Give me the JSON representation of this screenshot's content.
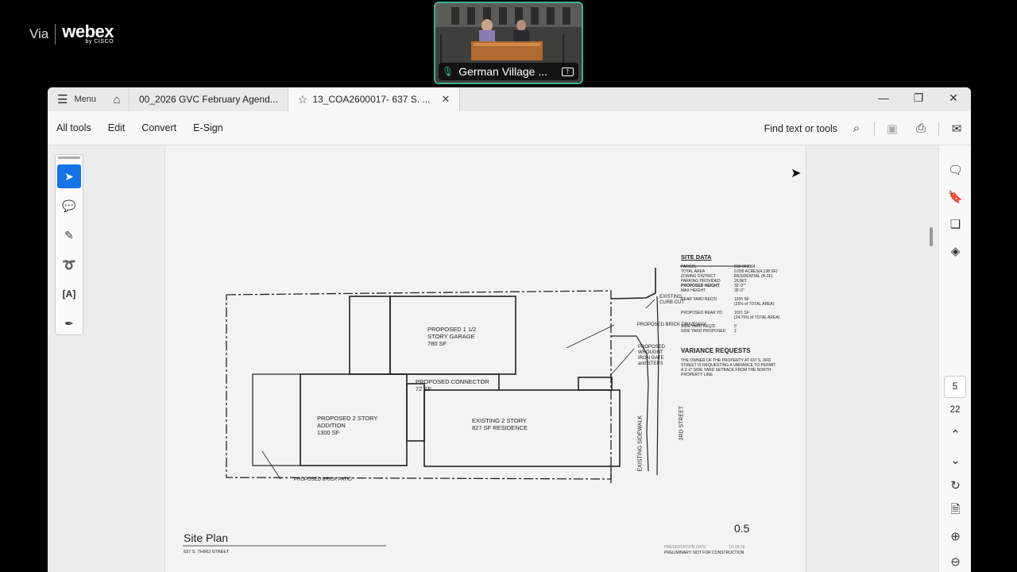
{
  "branding": {
    "via": "Via",
    "webex": "webex",
    "cisco": "by CISCO"
  },
  "video": {
    "participant_name": "German Village ..."
  },
  "window": {
    "menu_label": "Menu",
    "tabs": [
      {
        "label": "00_2026 GVC February Agend..."
      },
      {
        "label": "13_COA2600017- 637 S. ..."
      }
    ]
  },
  "toolbar": {
    "items": [
      "All tools",
      "Edit",
      "Convert",
      "E-Sign"
    ],
    "find_label": "Find text or tools"
  },
  "page_nav": {
    "current_page": "5",
    "total_pages": "22"
  },
  "drawing": {
    "site_data_title": "SITE DATA",
    "site_data_rows": [
      [
        "PARCEL",
        "010-003964"
      ],
      [
        "TOTAL AREA",
        "0.095 ACRES(4,138 SF)"
      ],
      [
        "ZONING DISTRICT",
        "RESIDENTIAL (R-2F)"
      ],
      [
        "PARKING PROVIDED",
        "2/UNIT"
      ],
      [
        "PROPOSED HEIGHT",
        "32'-0\"\""
      ],
      [
        "MAX HEIGHT",
        "35'-0\""
      ],
      [
        "REAR YARD REQ'D",
        "1035 SF"
      ],
      [
        "",
        "(25% of TOTAL AREA)"
      ],
      [
        "PROPOSED REAR YD",
        "1021 SF"
      ],
      [
        "",
        "(24.75% of TOTAL AREA)"
      ],
      [
        "SIDE YARD REQ'D",
        "5'"
      ],
      [
        "SIDE YARD PROPOSED",
        "1'"
      ]
    ],
    "variance_title": "VARIANCE REQUESTS",
    "variance_text": "THE OWNER OF THE PROPERTY AT 637 S. 3RD\nSTREET IS REQUESTING A VARIANCE TO PERMIT\nA 1'-0\" SIDE YARD SETBACK FROM THE NORTH\nPROPERTY LINE",
    "labels": {
      "garage": "PROPOSED 1 1/2\nSTORY GARAGE\n780 SF",
      "connector": "PROPOSED CONNECTOR\n72 SF",
      "addition": "PROPOSED 2 STORY\nADDITION\n1300 SF",
      "residence": "EXISTING 2 STORY\n827 SF RESIDENCE",
      "curb_cut": "EXISTING\nCURB CUT",
      "driveway": "PROPOSED BRICK DRIVEWAY",
      "gate": "PROPOSED\nWROUGHT\nIRON GATE\nand STEPS",
      "sidewalk": "EXISTING SIDEWALK",
      "street": "3RD STREET",
      "patio": "PROPOSED BRICK PATIO"
    },
    "sheet_title": "Site Plan",
    "sheet_subtitle": "637 S. THIRD STREET",
    "sheet_number": "0.5",
    "footer_left": "PRESENTATION DATE",
    "footer_date": "01.08.26",
    "footer_note": "PRELIMINARY: NOT FOR CONSTRUCTION"
  }
}
